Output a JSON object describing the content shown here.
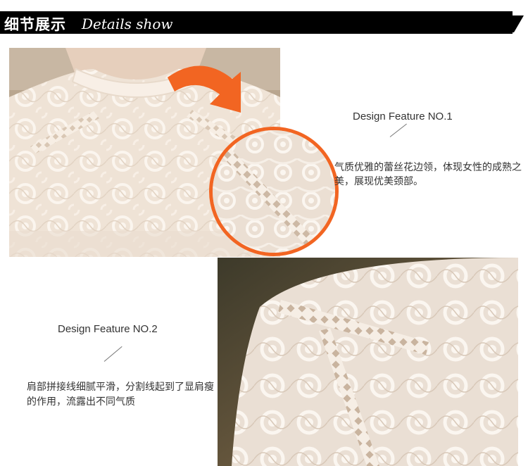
{
  "header": {
    "title_cn": "细节展示",
    "title_en": "Details show"
  },
  "feature1": {
    "title": "Design Feature NO.1",
    "description": "气质优雅的蕾丝花边领，体现女性的成熟之美，展现优美颈部。"
  },
  "feature2": {
    "title": "Design Feature NO.2",
    "description": "肩部拼接线细腻平滑，分割线起到了显肩瘦的作用，流露出不同气质"
  },
  "colors": {
    "accent": "#f26522",
    "header_bg": "#000000",
    "lace": "#f1e6db"
  },
  "icons": {
    "arrow": "curved-arrow-icon",
    "tail": "triangle-tail-icon"
  }
}
